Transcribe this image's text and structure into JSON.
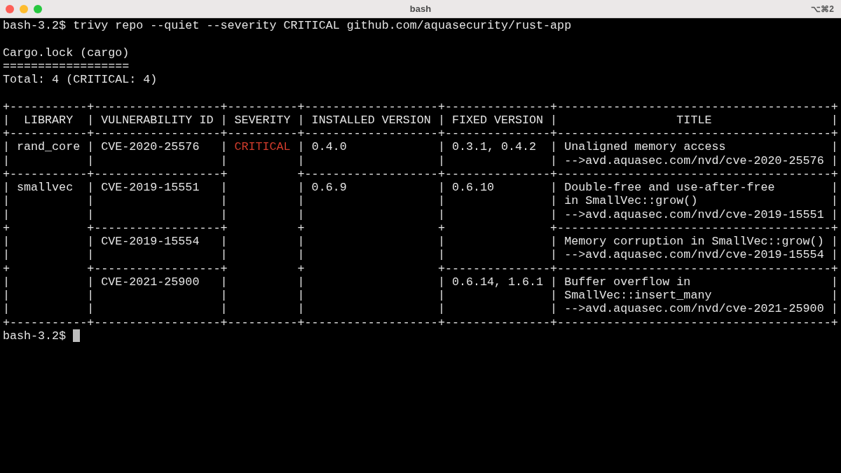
{
  "window": {
    "title": "bash",
    "shortcut": "⌥⌘2"
  },
  "command": "bash-3.2$ trivy repo --quiet --severity CRITICAL github.com/aquasecurity/rust-app",
  "report_header": [
    "Cargo.lock (cargo)",
    "==================",
    "Total: 4 (CRITICAL: 4)"
  ],
  "table_lines": [
    [
      {
        "text": "+-----------+------------------+----------+-------------------+---------------+---------------------------------------+",
        "kind": "plain"
      }
    ],
    [
      {
        "text": "|  LIBRARY  | VULNERABILITY ID | SEVERITY | INSTALLED VERSION | FIXED VERSION |                 TITLE                 |",
        "kind": "plain"
      }
    ],
    [
      {
        "text": "+-----------+------------------+----------+-------------------+---------------+---------------------------------------+",
        "kind": "plain"
      }
    ],
    [
      {
        "text": "| rand_core | CVE-2020-25576   | ",
        "kind": "plain"
      },
      {
        "text": "CRITICAL",
        "kind": "critical"
      },
      {
        "text": " | 0.4.0             | 0.3.1, 0.4.2  | Unaligned memory access               |",
        "kind": "plain"
      }
    ],
    [
      {
        "text": "|           |                  |          |                   |               | -->avd.aquasec.com/nvd/cve-2020-25576 |",
        "kind": "plain"
      }
    ],
    [
      {
        "text": "+-----------+------------------+          +-------------------+---------------+---------------------------------------+",
        "kind": "plain"
      }
    ],
    [
      {
        "text": "| smallvec  | CVE-2019-15551   |          | 0.6.9             | 0.6.10        | Double-free and use-after-free        |",
        "kind": "plain"
      }
    ],
    [
      {
        "text": "|           |                  |          |                   |               | in SmallVec::grow()                   |",
        "kind": "plain"
      }
    ],
    [
      {
        "text": "|           |                  |          |                   |               | -->avd.aquasec.com/nvd/cve-2019-15551 |",
        "kind": "plain"
      }
    ],
    [
      {
        "text": "+           +------------------+          +                   +               +---------------------------------------+",
        "kind": "plain"
      }
    ],
    [
      {
        "text": "|           | CVE-2019-15554   |          |                   |               | Memory corruption in SmallVec::grow() |",
        "kind": "plain"
      }
    ],
    [
      {
        "text": "|           |                  |          |                   |               | -->avd.aquasec.com/nvd/cve-2019-15554 |",
        "kind": "plain"
      }
    ],
    [
      {
        "text": "+           +------------------+          +                   +---------------+---------------------------------------+",
        "kind": "plain"
      }
    ],
    [
      {
        "text": "|           | CVE-2021-25900   |          |                   | 0.6.14, 1.6.1 | Buffer overflow in                    |",
        "kind": "plain"
      }
    ],
    [
      {
        "text": "|           |                  |          |                   |               | SmallVec::insert_many                 |",
        "kind": "plain"
      }
    ],
    [
      {
        "text": "|           |                  |          |                   |               | -->avd.aquasec.com/nvd/cve-2021-25900 |",
        "kind": "plain"
      }
    ],
    [
      {
        "text": "+-----------+------------------+----------+-------------------+---------------+---------------------------------------+",
        "kind": "plain"
      }
    ]
  ],
  "prompt": "bash-3.2$"
}
